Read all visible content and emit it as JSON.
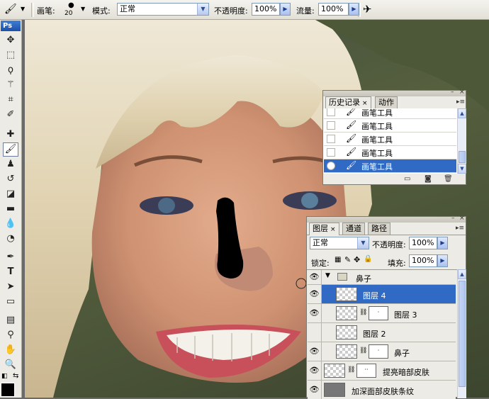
{
  "options_bar": {
    "brush_label": "画笔:",
    "brush_size": "20",
    "mode_label": "模式:",
    "mode_value": "正常",
    "opacity_label": "不透明度:",
    "opacity_value": "100%",
    "flow_label": "流量:",
    "flow_value": "100%"
  },
  "toolbox": {
    "logo": "Ps"
  },
  "history_panel": {
    "tabs": [
      {
        "label": "历史记录"
      },
      {
        "label": "动作"
      }
    ],
    "items": [
      {
        "label": "画笔工具"
      },
      {
        "label": "画笔工具"
      },
      {
        "label": "画笔工具"
      },
      {
        "label": "画笔工具"
      },
      {
        "label": "画笔工具"
      }
    ],
    "selected_index": 4
  },
  "layers_panel": {
    "tabs": [
      {
        "label": "图层"
      },
      {
        "label": "通道"
      },
      {
        "label": "路径"
      }
    ],
    "blend_mode": "正常",
    "opacity_label": "不透明度:",
    "opacity_value": "100%",
    "lock_label": "锁定:",
    "fill_label": "填充:",
    "fill_value": "100%",
    "layers": [
      {
        "name": "鼻子",
        "type": "group"
      },
      {
        "name": "图层 4",
        "type": "layer",
        "selected": true
      },
      {
        "name": "图层 3",
        "type": "masked"
      },
      {
        "name": "图层 2",
        "type": "layer"
      },
      {
        "name": "鼻子",
        "type": "masked"
      },
      {
        "name": "提亮暗部皮肤",
        "type": "masked"
      },
      {
        "name": "加深面部皮肤条纹",
        "type": "layer"
      }
    ]
  },
  "colors": {
    "selection": "#316ac5",
    "panel_bg": "#ecebe5",
    "field_border": "#7f9db9"
  }
}
